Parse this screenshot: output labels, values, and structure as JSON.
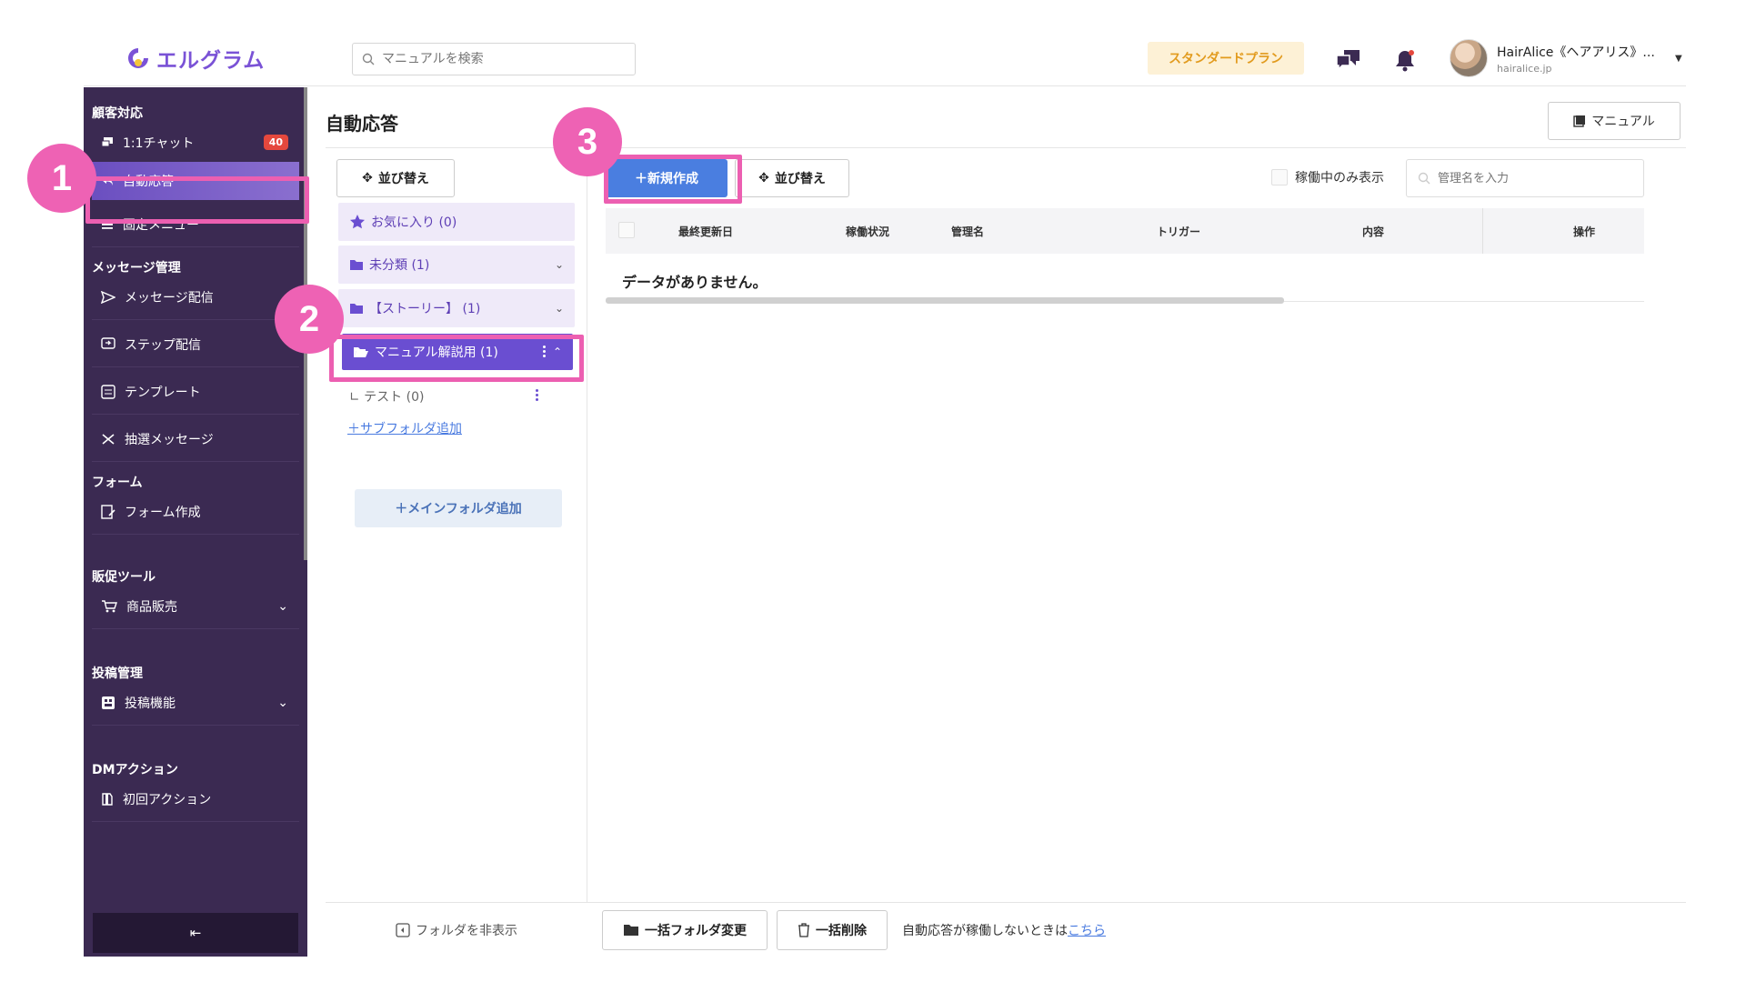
{
  "app": {
    "logo_text": "エルグラム",
    "search_placeholder": "マニュアルを検索",
    "plan_label": "スタンダードプラン",
    "user_name": "HairAlice《ヘアアリス》...",
    "user_domain": "hairalice.jp",
    "brand_color": "#7a52d6"
  },
  "sidebar": {
    "sections": [
      {
        "title": "顧客対応",
        "items": [
          {
            "label": "1:1チャット",
            "icon": "chat-icon",
            "badge": "40"
          },
          {
            "label": "自動応答",
            "icon": "reply-icon",
            "active": true
          },
          {
            "label": "固定メニュー",
            "icon": "menu-icon"
          }
        ]
      },
      {
        "title": "メッセージ管理",
        "items": [
          {
            "label": "メッセージ配信",
            "icon": "send-icon"
          },
          {
            "label": "ステップ配信",
            "icon": "step-icon"
          },
          {
            "label": "テンプレート",
            "icon": "template-icon"
          },
          {
            "label": "抽選メッセージ",
            "icon": "shuffle-icon"
          }
        ]
      },
      {
        "title": "フォーム",
        "items": [
          {
            "label": "フォーム作成",
            "icon": "form-icon"
          }
        ]
      },
      {
        "title": "販促ツール",
        "items": [
          {
            "label": "商品販売",
            "icon": "cart-icon"
          }
        ]
      },
      {
        "title": "投稿管理",
        "items": [
          {
            "label": "投稿機能",
            "icon": "post-icon"
          }
        ]
      },
      {
        "title": "DMアクション",
        "items": [
          {
            "label": "初回アクション",
            "icon": "first-action-icon"
          }
        ]
      }
    ]
  },
  "page": {
    "title": "自動応答",
    "manual_button": "マニュアル"
  },
  "folders": {
    "sort_button": "並び替え",
    "items": [
      {
        "label": "お気に入り (0)",
        "icon": "star-icon"
      },
      {
        "label": "未分類 (1)",
        "icon": "folder-icon"
      },
      {
        "label": "【ストーリー】 (1)",
        "icon": "folder-icon"
      },
      {
        "label": "マニュアル解説用 (1)",
        "icon": "folder-open-icon",
        "selected": true
      }
    ],
    "subfolder": "∟ テスト (0)",
    "add_subfolder": "＋サブフォルダ追加",
    "add_main_folder": "＋メインフォルダ追加",
    "hide_folders": "フォルダを非表示"
  },
  "main": {
    "new_button": "＋新規作成",
    "sort_button": "並び替え",
    "active_only_label": "稼働中のみ表示",
    "name_search_placeholder": "管理名を入力",
    "columns": [
      "最終更新日",
      "稼働状況",
      "管理名",
      "トリガー",
      "内容",
      "操作"
    ],
    "empty_message": "データがありません。",
    "bulk_folder_button": "一括フォルダ変更",
    "bulk_delete_button": "一括削除",
    "footer_note": "自動応答が稼働しないときは",
    "footer_link": "こちら"
  },
  "annotations": {
    "steps": [
      "1",
      "2",
      "3"
    ],
    "highlight_color": "#ec5fb1"
  }
}
